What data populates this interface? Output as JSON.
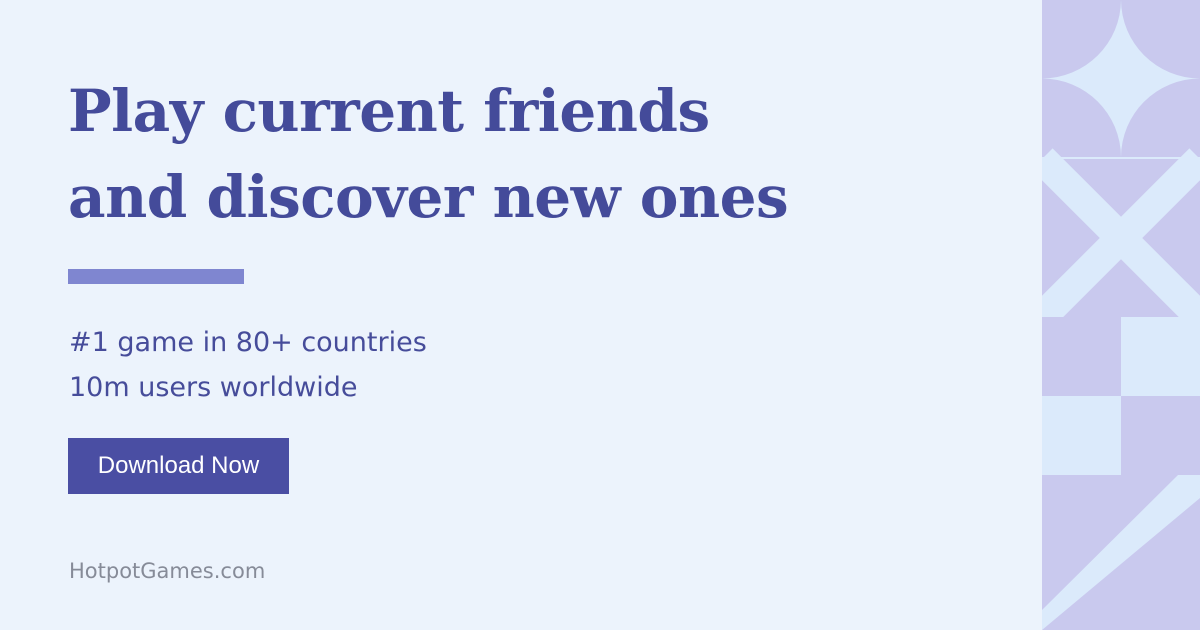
{
  "headline": {
    "line1": "Play current friends",
    "line2": "and discover new ones"
  },
  "stats": {
    "line1": "#1 game in 80+ countries",
    "line2": "10m users worldwide"
  },
  "cta": {
    "label": "Download Now"
  },
  "footer": {
    "site": "HotpotGames.com"
  },
  "decoration": {
    "tiles": [
      "four-point-star",
      "x-cross",
      "checkerboard",
      "diagonal-stripe"
    ]
  },
  "colors": {
    "background": "#ecf3fc",
    "headline": "#444b9a",
    "accent_bar": "#7f86d0",
    "stats_text": "#464c9a",
    "button": "#4a4ea3",
    "button_text": "#ffffff",
    "footer_text": "#868b98",
    "pattern_light": "#dbeafb",
    "pattern_dark": "#c9c9ee"
  }
}
